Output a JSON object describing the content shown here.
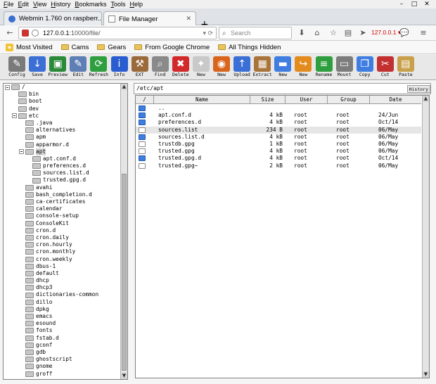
{
  "browser": {
    "menu": [
      "File",
      "Edit",
      "View",
      "History",
      "Bookmarks",
      "Tools",
      "Help"
    ],
    "tabs": [
      {
        "label": "Webmin 1.760 on raspberr..."
      },
      {
        "label": "File Manager"
      }
    ],
    "url": {
      "host": "127.0.0.1",
      "rest": ":10000/file/"
    },
    "search_placeholder": "Search",
    "ip_label": "127.0.0.1",
    "bookmarks": [
      "Most Visited",
      "Cams",
      "Gears",
      "From Google Chrome",
      "All Things Hidden"
    ]
  },
  "toolbar": {
    "buttons": [
      {
        "label": "Config",
        "icon": "wrench-icon",
        "color": "#7a7a7a",
        "glyph": "✎"
      },
      {
        "label": "Save",
        "icon": "save-arrow-icon",
        "color": "#3b6fd6",
        "glyph": "↓"
      },
      {
        "label": "Preview",
        "icon": "preview-icon",
        "color": "#2a8a3a",
        "glyph": "▣"
      },
      {
        "label": "Edit",
        "icon": "edit-icon",
        "color": "#5d7fb5",
        "glyph": "✎"
      },
      {
        "label": "Refresh",
        "icon": "refresh-icon",
        "color": "#2e9e3e",
        "glyph": "⟳"
      },
      {
        "label": "Info",
        "icon": "info-icon",
        "color": "#2a5ed0",
        "glyph": "i"
      },
      {
        "label": "EXT",
        "icon": "hammer-icon",
        "color": "#9b6a3a",
        "glyph": "⚒"
      },
      {
        "label": "Find",
        "icon": "magnifier-icon",
        "color": "#8a8a8a",
        "glyph": "⌕"
      },
      {
        "label": "Delete",
        "icon": "delete-icon",
        "color": "#d22a2a",
        "glyph": "✖"
      },
      {
        "label": "New",
        "icon": "new-file-icon",
        "color": "#c9c9c9",
        "glyph": "✦"
      },
      {
        "label": "New",
        "icon": "firefox-icon",
        "color": "#d9651c",
        "glyph": "◉"
      },
      {
        "label": "Upload",
        "icon": "upload-icon",
        "color": "#3b6fd6",
        "glyph": "↑"
      },
      {
        "label": "Extract",
        "icon": "extract-box-icon",
        "color": "#a8743a",
        "glyph": "▦"
      },
      {
        "label": "New",
        "icon": "new-folder-icon",
        "color": "#3f7ee0",
        "glyph": "▬"
      },
      {
        "label": "New",
        "icon": "new-link-icon",
        "color": "#e48b1f",
        "glyph": "↪"
      },
      {
        "label": "Rename",
        "icon": "rename-icon",
        "color": "#2e9e3e",
        "glyph": "≡"
      },
      {
        "label": "Mount",
        "icon": "mount-icon",
        "color": "#7d7d7d",
        "glyph": "▭"
      },
      {
        "label": "Copy",
        "icon": "copy-icon",
        "color": "#3f7ee0",
        "glyph": "❐"
      },
      {
        "label": "Cut",
        "icon": "scissors-icon",
        "color": "#c23030",
        "glyph": "✂"
      },
      {
        "label": "Paste",
        "icon": "paste-icon",
        "color": "#c8a04a",
        "glyph": "▤"
      }
    ]
  },
  "tree": {
    "nodes": [
      {
        "label": "/",
        "depth": 0,
        "open": true
      },
      {
        "label": "bin",
        "depth": 1
      },
      {
        "label": "boot",
        "depth": 1
      },
      {
        "label": "dev",
        "depth": 1
      },
      {
        "label": "etc",
        "depth": 1,
        "open": true
      },
      {
        "label": ".java",
        "depth": 2
      },
      {
        "label": "alternatives",
        "depth": 2
      },
      {
        "label": "apm",
        "depth": 2
      },
      {
        "label": "apparmor.d",
        "depth": 2
      },
      {
        "label": "apt",
        "depth": 2,
        "open": true,
        "selected": true
      },
      {
        "label": "apt.conf.d",
        "depth": 3
      },
      {
        "label": "preferences.d",
        "depth": 3
      },
      {
        "label": "sources.list.d",
        "depth": 3
      },
      {
        "label": "trusted.gpg.d",
        "depth": 3
      },
      {
        "label": "avahi",
        "depth": 2
      },
      {
        "label": "bash_completion.d",
        "depth": 2
      },
      {
        "label": "ca-certificates",
        "depth": 2
      },
      {
        "label": "calendar",
        "depth": 2
      },
      {
        "label": "console-setup",
        "depth": 2
      },
      {
        "label": "ConsoleKit",
        "depth": 2
      },
      {
        "label": "cron.d",
        "depth": 2
      },
      {
        "label": "cron.daily",
        "depth": 2
      },
      {
        "label": "cron.hourly",
        "depth": 2
      },
      {
        "label": "cron.monthly",
        "depth": 2
      },
      {
        "label": "cron.weekly",
        "depth": 2
      },
      {
        "label": "dbus-1",
        "depth": 2
      },
      {
        "label": "default",
        "depth": 2
      },
      {
        "label": "dhcp",
        "depth": 2
      },
      {
        "label": "dhcp3",
        "depth": 2
      },
      {
        "label": "dictionaries-common",
        "depth": 2
      },
      {
        "label": "dillo",
        "depth": 2
      },
      {
        "label": "dpkg",
        "depth": 2
      },
      {
        "label": "emacs",
        "depth": 2
      },
      {
        "label": "esound",
        "depth": 2
      },
      {
        "label": "fonts",
        "depth": 2
      },
      {
        "label": "fstab.d",
        "depth": 2
      },
      {
        "label": "gconf",
        "depth": 2
      },
      {
        "label": "gdb",
        "depth": 2
      },
      {
        "label": "ghostscript",
        "depth": 2
      },
      {
        "label": "gnome",
        "depth": 2
      },
      {
        "label": "groff",
        "depth": 2
      }
    ]
  },
  "main": {
    "path": "/etc/apt",
    "history_label": "History",
    "columns": {
      "sort": "/",
      "name": "Name",
      "size": "Size",
      "user": "User",
      "group": "Group",
      "date": "Date"
    },
    "files": [
      {
        "type": "dir",
        "name": "..",
        "size": "",
        "user": "",
        "group": "",
        "date": ""
      },
      {
        "type": "dir",
        "name": "apt.conf.d",
        "size": "4 kB",
        "user": "root",
        "group": "root",
        "date": "24/Jun"
      },
      {
        "type": "dir",
        "name": "preferences.d",
        "size": "4 kB",
        "user": "root",
        "group": "root",
        "date": "Oct/14"
      },
      {
        "type": "file",
        "name": "sources.list",
        "size": "234 B",
        "user": "root",
        "group": "root",
        "date": "06/May",
        "selected": true
      },
      {
        "type": "dir",
        "name": "sources.list.d",
        "size": "4 kB",
        "user": "root",
        "group": "root",
        "date": "06/May"
      },
      {
        "type": "file",
        "name": "trustdb.gpg",
        "size": "1 kB",
        "user": "root",
        "group": "root",
        "date": "06/May"
      },
      {
        "type": "file",
        "name": "trusted.gpg",
        "size": "4 kB",
        "user": "root",
        "group": "root",
        "date": "06/May"
      },
      {
        "type": "dir",
        "name": "trusted.gpg.d",
        "size": "4 kB",
        "user": "root",
        "group": "root",
        "date": "Oct/14"
      },
      {
        "type": "file",
        "name": "trusted.gpg~",
        "size": "2 kB",
        "user": "root",
        "group": "root",
        "date": "06/May"
      }
    ]
  }
}
